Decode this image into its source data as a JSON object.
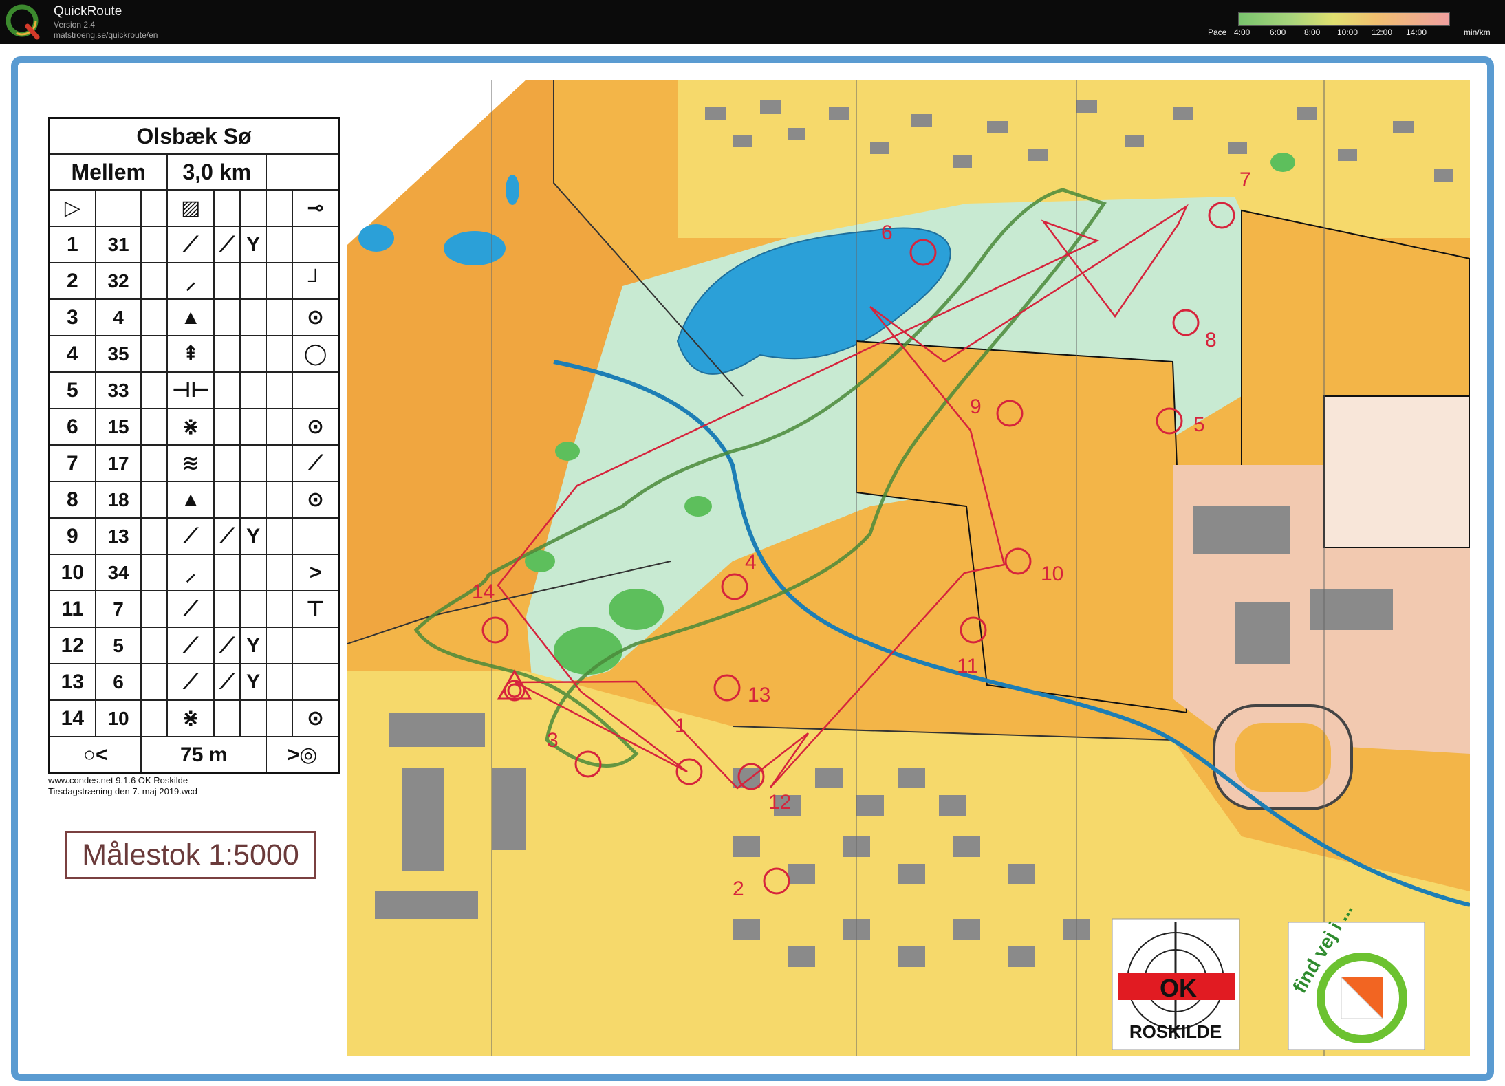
{
  "app": {
    "title": "QuickRoute",
    "version": "Version 2.4",
    "url": "matstroeng.se/quickroute/en"
  },
  "pace_legend": {
    "label": "Pace",
    "ticks": [
      "4:00",
      "6:00",
      "8:00",
      "10:00",
      "12:00",
      "14:00"
    ],
    "unit": "min/km",
    "colors": [
      "#79c46e",
      "#e0e070",
      "#f0a0a0"
    ]
  },
  "course": {
    "name": "Olsbæk Sø",
    "class": "Mellem",
    "length": "3,0 km",
    "controls": [
      {
        "num": "1",
        "code": "31"
      },
      {
        "num": "2",
        "code": "32"
      },
      {
        "num": "3",
        "code": "4"
      },
      {
        "num": "4",
        "code": "35"
      },
      {
        "num": "5",
        "code": "33"
      },
      {
        "num": "6",
        "code": "15"
      },
      {
        "num": "7",
        "code": "17"
      },
      {
        "num": "8",
        "code": "18"
      },
      {
        "num": "9",
        "code": "13"
      },
      {
        "num": "10",
        "code": "34"
      },
      {
        "num": "11",
        "code": "7"
      },
      {
        "num": "12",
        "code": "5"
      },
      {
        "num": "13",
        "code": "6"
      },
      {
        "num": "14",
        "code": "10"
      }
    ],
    "finish_distance": "75 m"
  },
  "credits": {
    "line1": "www.condes.net 9.1.6 OK Roskilde",
    "line2": "Tirsdagstræning den 7. maj 2019.wcd"
  },
  "scale": "Målestok 1:5000",
  "map_labels": {
    "controls": [
      "1",
      "2",
      "3",
      "4",
      "5",
      "6",
      "7",
      "8",
      "9",
      "10",
      "11",
      "12",
      "13",
      "14"
    ]
  },
  "logos": {
    "club_left": "OK",
    "club_name": "ROSKILDE",
    "right_text": "find vej i ..."
  },
  "colors": {
    "frame": "#5a9bd1",
    "course": "#d6243c",
    "open_land": "#f3b548",
    "forest": "#ffffff",
    "water": "#2ba0d8",
    "green": "#6cc26a",
    "route": "#4a8a3a"
  }
}
